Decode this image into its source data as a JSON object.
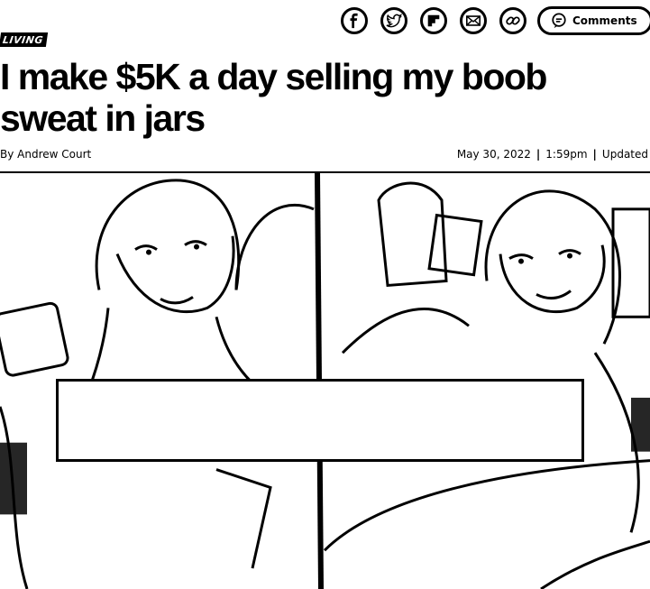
{
  "share": {
    "items": [
      {
        "name": "facebook",
        "icon": "facebook-icon"
      },
      {
        "name": "twitter",
        "icon": "twitter-icon"
      },
      {
        "name": "flipboard",
        "icon": "flipboard-icon"
      },
      {
        "name": "email",
        "icon": "envelope-icon"
      },
      {
        "name": "copy-link",
        "icon": "link-icon"
      }
    ],
    "comments_label": "Comments"
  },
  "article": {
    "section": "LIVING",
    "headline": "I make $5K a day selling my boob sweat in jars",
    "byline": "By Andrew Court",
    "date": "May 30, 2022",
    "time": "1:59pm",
    "updated_label": "Updated"
  }
}
